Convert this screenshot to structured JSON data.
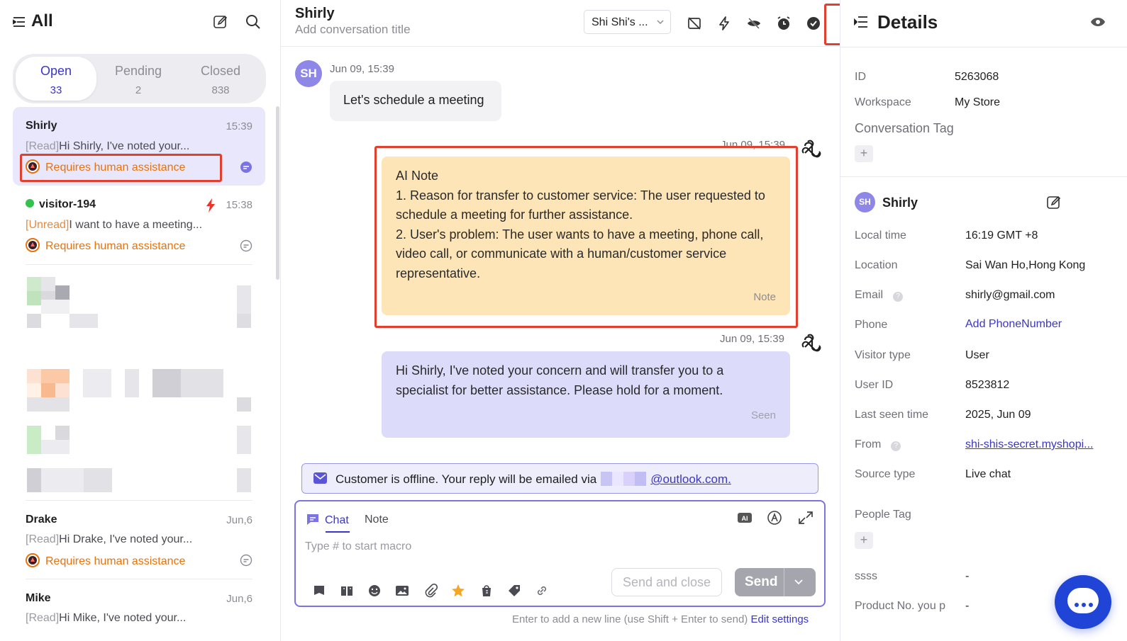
{
  "left": {
    "title": "All",
    "tabs": [
      {
        "label": "Open",
        "count": "33"
      },
      {
        "label": "Pending",
        "count": "2"
      },
      {
        "label": "Closed",
        "count": "838"
      }
    ],
    "conversations": [
      {
        "name": "Shirly",
        "time": "15:39",
        "tag": "[Read]",
        "preview": "Hi Shirly, I've noted your...",
        "assist": "Requires human assistance"
      },
      {
        "name": "visitor-194",
        "time": "15:38",
        "tag": "[Unread]",
        "preview": "I want to have a meeting...",
        "assist": "Requires human assistance"
      },
      {
        "name": "Drake",
        "time": "Jun,6",
        "tag": "[Read]",
        "preview": "Hi Drake, I've noted your...",
        "assist": "Requires human assistance"
      },
      {
        "name": "Mike",
        "time": "Jun,6",
        "tag": "[Read]",
        "preview": "Hi Mike, I've noted your..."
      }
    ]
  },
  "chat": {
    "name": "Shirly",
    "title_placeholder": "Add conversation title",
    "agent": "Shi Shi's ...",
    "messages": [
      {
        "avatar": "SH",
        "time": "Jun 09, 15:39",
        "text": "Let's schedule a meeting"
      },
      {
        "time": "Jun 09, 15:39",
        "title": "AI Note",
        "line1": "1. Reason for transfer to customer service: The user requested to schedule a meeting for further assistance.",
        "line2": "2. User's problem: The user wants to have a meeting, phone call, video call, or communicate with a human/customer service representative.",
        "label": "Note"
      },
      {
        "time": "Jun 09, 15:39",
        "text": "Hi Shirly, I've noted your concern and will transfer you to a specialist for better assistance. Please hold for a moment.",
        "label": "Seen"
      }
    ],
    "offline_text": "Customer is offline. Your reply will be emailed via",
    "offline_email": "@outlook.com.",
    "composer": {
      "tab_chat": "Chat",
      "tab_note": "Note",
      "placeholder": "Type # to start macro",
      "send_close": "Send and close",
      "send": "Send",
      "ai_badge": "AI"
    },
    "hint": "Enter to add a new line (use Shift + Enter to send)",
    "hint_link": "Edit settings"
  },
  "details": {
    "title": "Details",
    "id_label": "ID",
    "id": "5263068",
    "workspace_label": "Workspace",
    "workspace": "My Store",
    "conv_tag_label": "Conversation Tag",
    "user_avatar": "SH",
    "user_name": "Shirly",
    "fields": [
      {
        "label": "Local time",
        "value": "16:19 GMT +8"
      },
      {
        "label": "Location",
        "value": "Sai Wan Ho,Hong Kong"
      },
      {
        "label": "Email",
        "value": "shirly@gmail.com"
      },
      {
        "label": "Phone",
        "value": "Add PhoneNumber"
      },
      {
        "label": "Visitor type",
        "value": "User"
      },
      {
        "label": "User ID",
        "value": "8523812"
      },
      {
        "label": "Last seen time",
        "value": "2025, Jun 09"
      },
      {
        "label": "From",
        "value": "shi-shis-secret.myshopi..."
      },
      {
        "label": "Source type",
        "value": "Live chat"
      }
    ],
    "people_tag_label": "People Tag",
    "custom": [
      {
        "label": "ssss",
        "value": "-"
      },
      {
        "label": "Product No. you p",
        "value": "-"
      }
    ]
  },
  "colors": {
    "accent": "#3b35c9",
    "warning": "#e8730c",
    "note_bg": "#fde5b7",
    "highlight": "#e2402f"
  }
}
